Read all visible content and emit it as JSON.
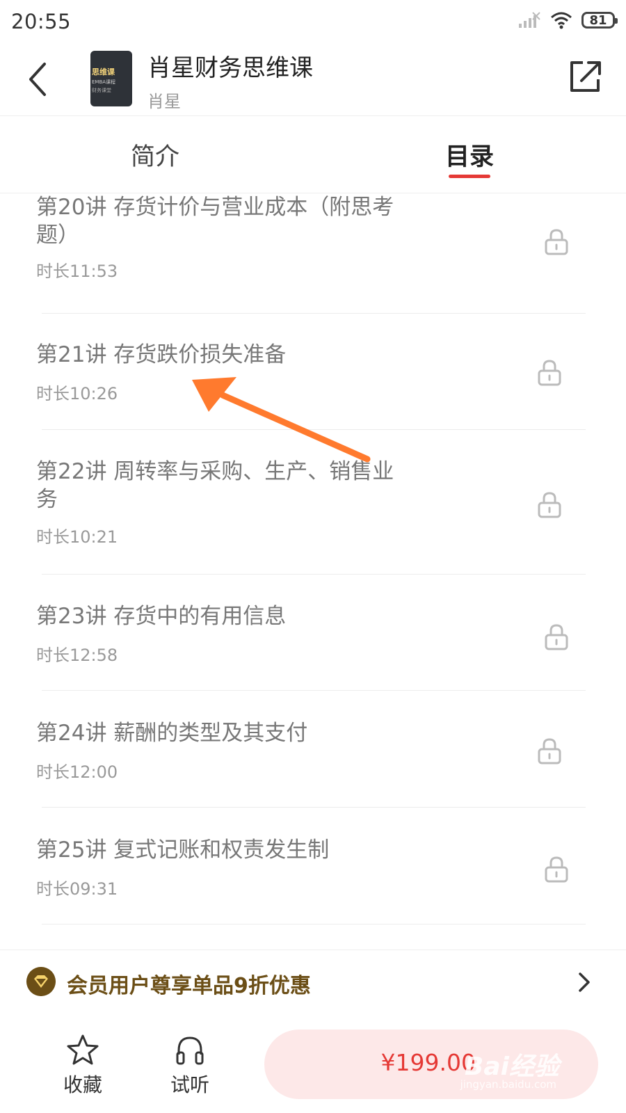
{
  "status_bar": {
    "time": "20:55",
    "battery": "81"
  },
  "header": {
    "title": "肖星财务思维课",
    "author": "肖星",
    "cover_title": "思维课",
    "cover_line2": "EMBA课程",
    "cover_line3": "财务课堂"
  },
  "tabs": {
    "intro": "简介",
    "catalog": "目录",
    "active": "catalog"
  },
  "lessons": [
    {
      "title": "第20讲 存货计价与营业成本（附思考题）",
      "duration": "时长11:53",
      "locked": true
    },
    {
      "title": "第21讲 存货跌价损失准备",
      "duration": "时长10:26",
      "locked": true
    },
    {
      "title": "第22讲 周转率与采购、生产、销售业务",
      "duration": "时长10:21",
      "locked": true
    },
    {
      "title": "第23讲 存货中的有用信息",
      "duration": "时长12:58",
      "locked": true
    },
    {
      "title": "第24讲 薪酬的类型及其支付",
      "duration": "时长12:00",
      "locked": true
    },
    {
      "title": "第25讲 复式记账和权责发生制",
      "duration": "时长09:31",
      "locked": true
    }
  ],
  "member_banner": {
    "text": "会员用户尊享单品9折优惠"
  },
  "bottom_bar": {
    "favorite_label": "收藏",
    "trial_label": "试听",
    "price": "¥199.00"
  },
  "watermark": {
    "brand": "Bai经验",
    "url": "jingyan.baidu.com"
  },
  "colors": {
    "accent": "#e53935",
    "member_gold": "#6b4e16",
    "annotation_arrow": "#ff7a2e"
  }
}
